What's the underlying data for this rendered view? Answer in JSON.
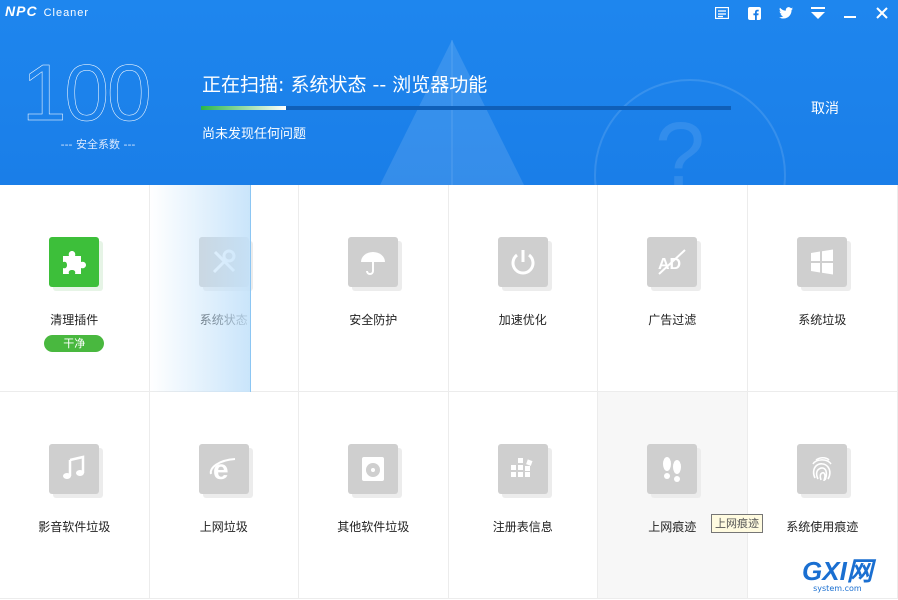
{
  "app": {
    "brand": "NPC",
    "name": "Cleaner"
  },
  "window_buttons": [
    {
      "name": "feedback-icon"
    },
    {
      "name": "facebook-icon"
    },
    {
      "name": "twitter-icon"
    },
    {
      "name": "menu-icon"
    },
    {
      "name": "minimize-icon"
    },
    {
      "name": "close-icon"
    }
  ],
  "header": {
    "score": "100",
    "score_label": "--- 安全系数 ---",
    "scan_title": "正在扫描: 系统状态 -- 浏览器功能",
    "progress": 0.16,
    "scan_status": "尚未发现任何问题",
    "cancel_label": "取消"
  },
  "items": [
    {
      "label": "清理插件",
      "icon": "puzzle-icon",
      "state": "done",
      "badge": "干净"
    },
    {
      "label": "系统状态",
      "icon": "tools-icon",
      "state": "scanning"
    },
    {
      "label": "安全防护",
      "icon": "umbrella-icon",
      "state": "pending"
    },
    {
      "label": "加速优化",
      "icon": "power-icon",
      "state": "pending"
    },
    {
      "label": "广告过滤",
      "icon": "ad-block-icon",
      "state": "pending"
    },
    {
      "label": "系统垃圾",
      "icon": "windows-icon",
      "state": "pending"
    },
    {
      "label": "影音软件垃圾",
      "icon": "music-icon",
      "state": "pending"
    },
    {
      "label": "上网垃圾",
      "icon": "ie-icon",
      "state": "pending"
    },
    {
      "label": "其他软件垃圾",
      "icon": "disc-icon",
      "state": "pending"
    },
    {
      "label": "注册表信息",
      "icon": "registry-icon",
      "state": "pending"
    },
    {
      "label": "上网痕迹",
      "icon": "footprints-icon",
      "state": "pending"
    },
    {
      "label": "系统使用痕迹",
      "icon": "fingerprint-icon",
      "state": "pending"
    }
  ],
  "tooltip": "上网痕迹",
  "watermark": {
    "big": "GXI网",
    "small": "system.com"
  },
  "colors": {
    "header_blue": "#1a7ee8",
    "clean_green": "#3dbf3a",
    "icon_grey": "#cfcfcf"
  }
}
